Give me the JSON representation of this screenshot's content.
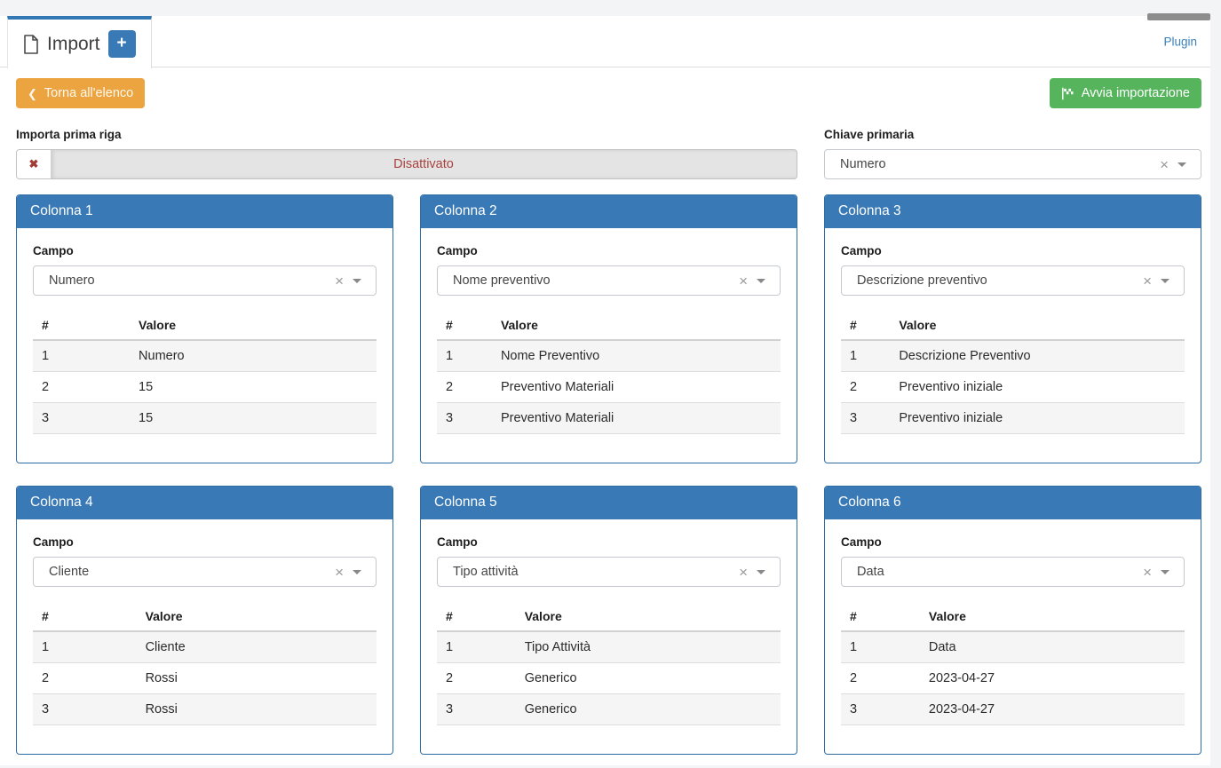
{
  "header": {
    "tab_label": "Import",
    "add_button_label": "+",
    "plugin_link_label": "Plugin"
  },
  "toolbar": {
    "back_label": "Torna all'elenco",
    "start_label": "Avvia importazione"
  },
  "settings": {
    "first_row_label": "Importa prima riga",
    "first_row_status": "Disattivato",
    "primary_key_label": "Chiave primaria",
    "primary_key_value": "Numero"
  },
  "cards_common": {
    "field_label": "Campo",
    "num_header": "#",
    "value_header": "Valore"
  },
  "columns": [
    {
      "title": "Colonna 1",
      "field_value": "Numero",
      "rows": [
        [
          "1",
          "Numero"
        ],
        [
          "2",
          "15"
        ],
        [
          "3",
          "15"
        ]
      ]
    },
    {
      "title": "Colonna 2",
      "field_value": "Nome preventivo",
      "rows": [
        [
          "1",
          "Nome Preventivo"
        ],
        [
          "2",
          "Preventivo Materiali"
        ],
        [
          "3",
          "Preventivo Materiali"
        ]
      ]
    },
    {
      "title": "Colonna 3",
      "field_value": "Descrizione preventivo",
      "rows": [
        [
          "1",
          "Descrizione Preventivo"
        ],
        [
          "2",
          "Preventivo iniziale"
        ],
        [
          "3",
          "Preventivo iniziale"
        ]
      ]
    },
    {
      "title": "Colonna 4",
      "field_value": "Cliente",
      "rows": [
        [
          "1",
          "Cliente"
        ],
        [
          "2",
          "Rossi"
        ],
        [
          "3",
          "Rossi"
        ]
      ]
    },
    {
      "title": "Colonna 5",
      "field_value": "Tipo attività",
      "rows": [
        [
          "1",
          "Tipo Attività"
        ],
        [
          "2",
          "Generico"
        ],
        [
          "3",
          "Generico"
        ]
      ]
    },
    {
      "title": "Colonna 6",
      "field_value": "Data",
      "rows": [
        [
          "1",
          "Data"
        ],
        [
          "2",
          "2023-04-27"
        ],
        [
          "3",
          "2023-04-27"
        ]
      ]
    }
  ],
  "icons": {
    "clear": "×",
    "toggle_off": "✖",
    "chevron_left": "❮"
  },
  "colors": {
    "accent_blue": "#3879b6",
    "card_border_blue": "#2e6da4",
    "tab_border_blue": "#3178b5",
    "button_orange": "#eca440",
    "button_green": "#55b45c",
    "status_red": "#a8423e",
    "link_blue": "#3a80ba"
  }
}
